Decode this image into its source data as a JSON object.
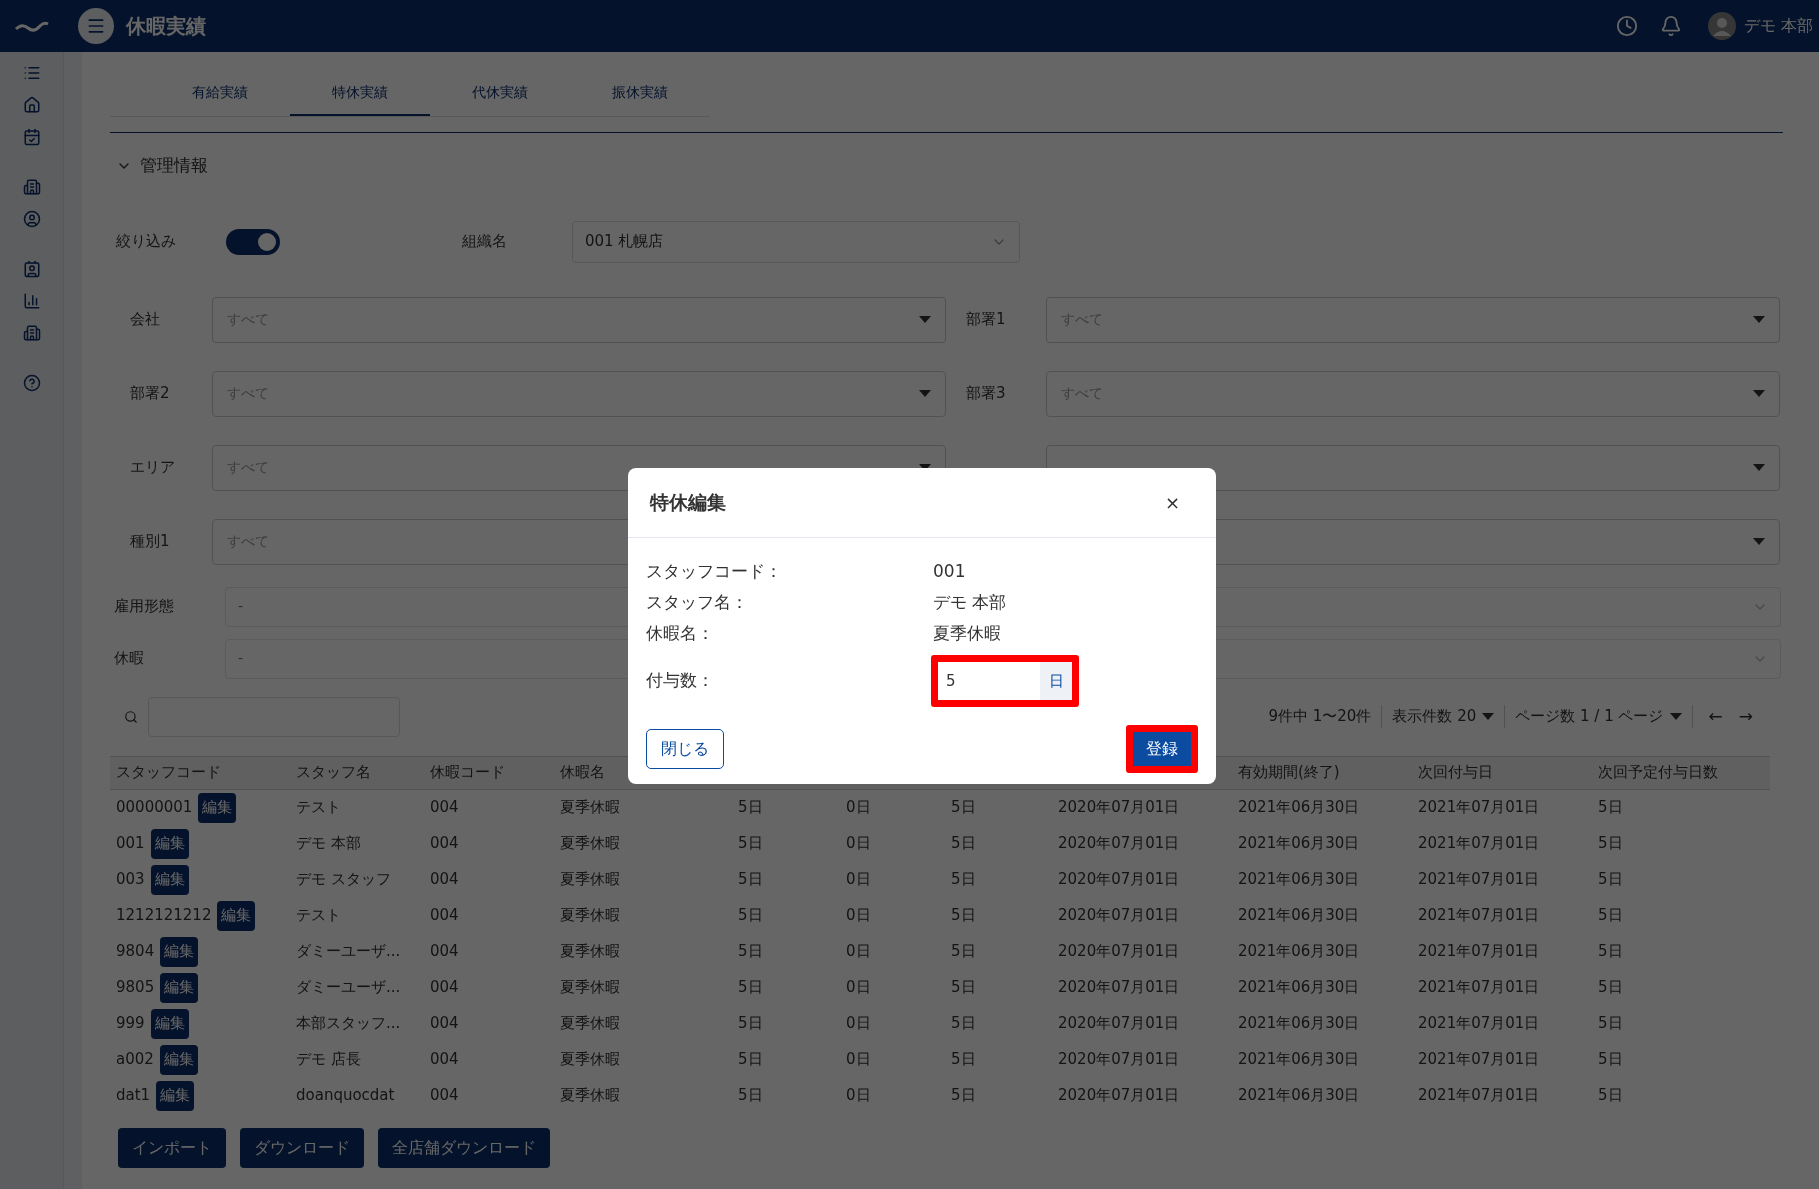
{
  "header": {
    "title": "休暇実績",
    "user_name": "デモ 本部"
  },
  "tabs": [
    {
      "label": "有給実績",
      "selected": false
    },
    {
      "label": "特休実績",
      "selected": true
    },
    {
      "label": "代休実績",
      "selected": false
    },
    {
      "label": "振休実績",
      "selected": false
    }
  ],
  "section": {
    "title": "管理情報",
    "expanded": true
  },
  "filter": {
    "label": "絞り込み",
    "on": true,
    "org_label": "組織名",
    "org_value": "001 札幌店"
  },
  "selects": [
    {
      "label": "会社",
      "placeholder": "すべて",
      "right_label": "部署1",
      "right_placeholder": "すべて"
    },
    {
      "label": "部署2",
      "placeholder": "すべて",
      "right_label": "部署3",
      "right_placeholder": "すべて"
    },
    {
      "label": "エリア",
      "placeholder": "すべて"
    },
    {
      "label": "種別1",
      "placeholder": "すべて"
    }
  ],
  "plain_selects": [
    {
      "label": "雇用形態",
      "value": "-"
    },
    {
      "label": "休暇",
      "value": "-"
    }
  ],
  "pagination": {
    "summary": "9件中 1〜20件",
    "per_page": "表示件数 20",
    "page": "ページ数 1 / 1 ページ",
    "prev": "←",
    "next": "→"
  },
  "table": {
    "columns": [
      {
        "label": "スタッフコード"
      },
      {
        "label": "スタッフ名"
      },
      {
        "label": "休暇コード"
      },
      {
        "label": "休暇名"
      },
      {},
      {},
      {},
      {},
      {
        "label": "有効期間(終了)"
      },
      {
        "label": "次回付与日"
      },
      {
        "label": "次回予定付与日数"
      }
    ],
    "rows": [
      {
        "edit": "編集",
        "cells": [
          "00000001",
          "テスト",
          "004",
          "夏季休暇",
          "5日",
          "0日",
          "5日",
          "2020年07月01日",
          "2021年06月30日",
          "2021年07月01日",
          "5日"
        ]
      },
      {
        "edit": "編集",
        "cells": [
          "001",
          "デモ 本部",
          "004",
          "夏季休暇",
          "5日",
          "0日",
          "5日",
          "2020年07月01日",
          "2021年06月30日",
          "2021年07月01日",
          "5日"
        ]
      },
      {
        "edit": "編集",
        "cells": [
          "003",
          "デモ スタッフ",
          "004",
          "夏季休暇",
          "5日",
          "0日",
          "5日",
          "2020年07月01日",
          "2021年06月30日",
          "2021年07月01日",
          "5日"
        ]
      },
      {
        "edit": "編集",
        "cells": [
          "1212121212",
          "テスト",
          "004",
          "夏季休暇",
          "5日",
          "0日",
          "5日",
          "2020年07月01日",
          "2021年06月30日",
          "2021年07月01日",
          "5日"
        ]
      },
      {
        "edit": "編集",
        "cells": [
          "9804",
          "ダミーユーザ...",
          "004",
          "夏季休暇",
          "5日",
          "0日",
          "5日",
          "2020年07月01日",
          "2021年06月30日",
          "2021年07月01日",
          "5日"
        ]
      },
      {
        "edit": "編集",
        "cells": [
          "9805",
          "ダミーユーザ...",
          "004",
          "夏季休暇",
          "5日",
          "0日",
          "5日",
          "2020年07月01日",
          "2021年06月30日",
          "2021年07月01日",
          "5日"
        ]
      },
      {
        "edit": "編集",
        "cells": [
          "999",
          "本部スタッフ...",
          "004",
          "夏季休暇",
          "5日",
          "0日",
          "5日",
          "2020年07月01日",
          "2021年06月30日",
          "2021年07月01日",
          "5日"
        ]
      },
      {
        "edit": "編集",
        "cells": [
          "a002",
          "デモ 店長",
          "004",
          "夏季休暇",
          "5日",
          "0日",
          "5日",
          "2020年07月01日",
          "2021年06月30日",
          "2021年07月01日",
          "5日"
        ]
      },
      {
        "edit": "編集",
        "cells": [
          "dat1",
          "doanquocdat",
          "004",
          "夏季休暇",
          "5日",
          "0日",
          "5日",
          "2020年07月01日",
          "2021年06月30日",
          "2021年07月01日",
          "5日"
        ]
      }
    ]
  },
  "actions": [
    "インポート",
    "ダウンロード",
    "全店舗ダウンロード"
  ],
  "dialog": {
    "title": "特休編集",
    "close": "×",
    "fields": [
      {
        "label": "スタッフコード：",
        "value": "001"
      },
      {
        "label": "スタッフ名：",
        "value": "デモ 本部"
      },
      {
        "label": "休暇名：",
        "value": "夏季休暇"
      }
    ],
    "input": {
      "label": "付与数：",
      "value": "5",
      "unit": "日",
      "highlighted": true
    },
    "cancel": "閉じる",
    "submit": {
      "label": "登録",
      "highlighted": true
    }
  }
}
